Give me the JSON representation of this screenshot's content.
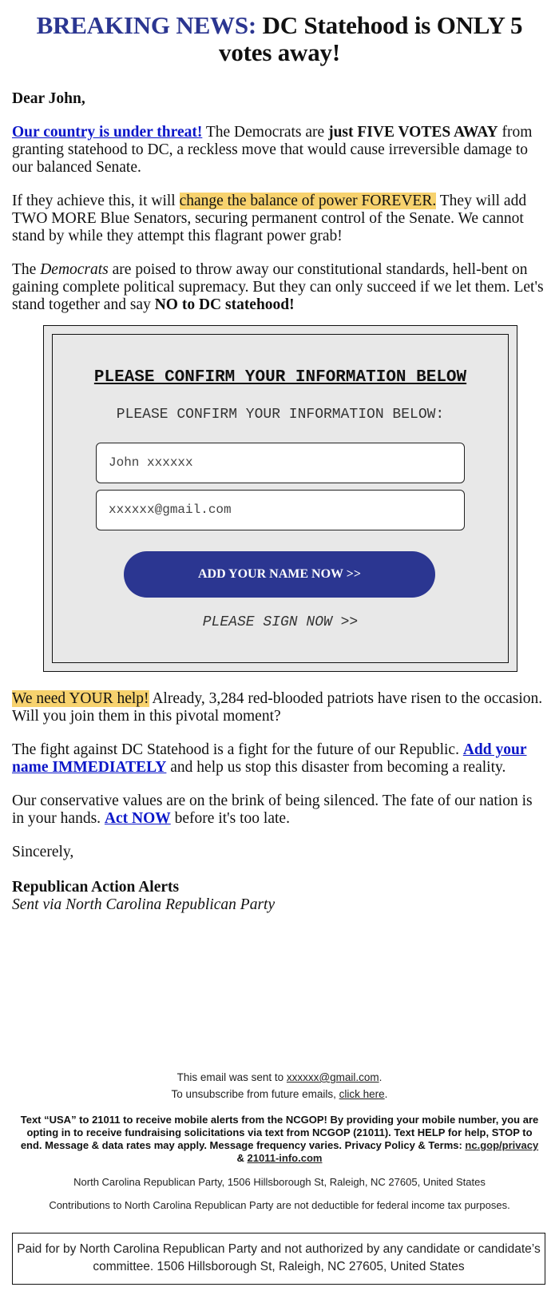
{
  "headline": {
    "prefix": "BREAKING NEWS:",
    "rest": " DC Statehood is ONLY 5 votes away!"
  },
  "colors": {
    "brand_blue": "#2b3691",
    "link_blue": "#0b16c8",
    "highlight": "#f7d26e",
    "form_bg": "#e8e8e8"
  },
  "greeting": "Dear John,",
  "paragraphs": {
    "p1": {
      "link": "Our country is under threat!",
      "t1": " The Democrats are ",
      "bold": "just FIVE VOTES AWAY",
      "t2": " from granting statehood to DC, a reckless move that would cause irreversible damage to our balanced Senate."
    },
    "p2": {
      "t1": "If they achieve this, it will ",
      "highlight": "change the balance of power FOREVER.",
      "t2": " They will add TWO MORE Blue Senators, securing permanent control of the Senate. We cannot stand by while they attempt this flagrant power grab!"
    },
    "p3": {
      "t1": "The ",
      "italic": "Democrats",
      "t2": " are poised to throw away our constitutional standards, hell-bent on gaining complete political supremacy. But they can only succeed if we let them. Let's stand together and say ",
      "bold": "NO to DC statehood!"
    },
    "p4": {
      "highlight": "We need YOUR help!",
      "t1": " Already, 3,284 red-blooded patriots have risen to the occasion. Will you join them in this pivotal moment?"
    },
    "p5": {
      "t1": "The fight against DC Statehood is a fight for the future of our Republic. ",
      "link": "Add your name IMMEDIATELY",
      "t2": " and help us stop this disaster from becoming a reality."
    },
    "p6": {
      "t1": "Our conservative values are on the brink of being silenced. The fate of our nation is in your hands. ",
      "link": "Act NOW",
      "t2": " before it's too late."
    }
  },
  "form": {
    "title": "PLEASE CONFIRM YOUR INFORMATION BELOW",
    "subtitle": "PLEASE CONFIRM YOUR INFORMATION BELOW:",
    "name_value": "John xxxxxx",
    "email_value": "xxxxxx@gmail.com",
    "cta_label": "ADD YOUR NAME NOW >>",
    "sign_label": "PLEASE SIGN NOW >>"
  },
  "signoff": {
    "closing": "Sincerely,",
    "sender": "Republican Action Alerts",
    "via": "Sent via North Carolina Republican Party"
  },
  "footer": {
    "sent_to_prefix": "This email was sent to ",
    "sent_to_email": "xxxxxx@gmail.com",
    "sent_to_suffix": ".",
    "unsub_prefix": "To unsubscribe from future emails, ",
    "unsub_link": "click here",
    "unsub_suffix": ".",
    "sms_text": "Text “USA” to 21011 to receive mobile alerts from the NCGOP! By providing your mobile number, you are opting in to receive fundraising solicitations via text from NCGOP (21011). Text HELP for help, STOP to end. Message & data rates may apply. Message frequency varies. Privacy Policy & Terms: ",
    "privacy_link": "nc.gop/privacy",
    "amp": " & ",
    "terms_link": "21011-info.com",
    "address": "North Carolina Republican Party, 1506 Hillsborough St, Raleigh, NC 27605, United States",
    "deductible": "Contributions to North Carolina Republican Party are not deductible for federal income tax purposes.",
    "paid_for": "Paid for by North Carolina Republican Party and not authorized by any candidate or candidate’s committee. 1506 Hillsborough St, Raleigh, NC 27605, United States"
  }
}
